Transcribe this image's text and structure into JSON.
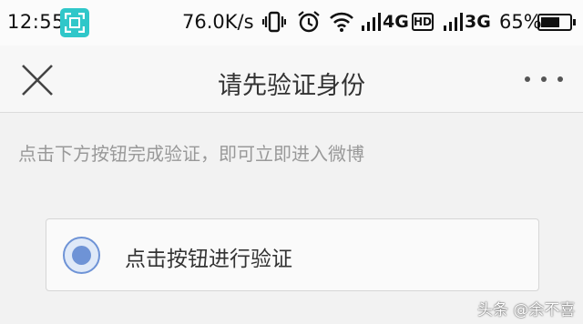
{
  "status_bar": {
    "time": "12:55",
    "speed": "76.0K/s",
    "net1": "4G",
    "hd": "HD",
    "net2": "3G",
    "battery_pct_text": "65%",
    "battery_level": 0.65,
    "icons": [
      "screen-scan-icon",
      "vibrate-icon",
      "alarm-icon",
      "wifi-icon",
      "signal-icon",
      "battery-icon"
    ]
  },
  "header": {
    "title": "请先验证身份",
    "close_icon": "close-icon",
    "more_icon": "more-icon"
  },
  "content": {
    "hint": "点击下方按钮完成验证，即可立即进入微博",
    "verify_button_label": "点击按钮进行验证",
    "accent_color": "#6e93d6"
  },
  "watermark": "头条 @余不喜"
}
